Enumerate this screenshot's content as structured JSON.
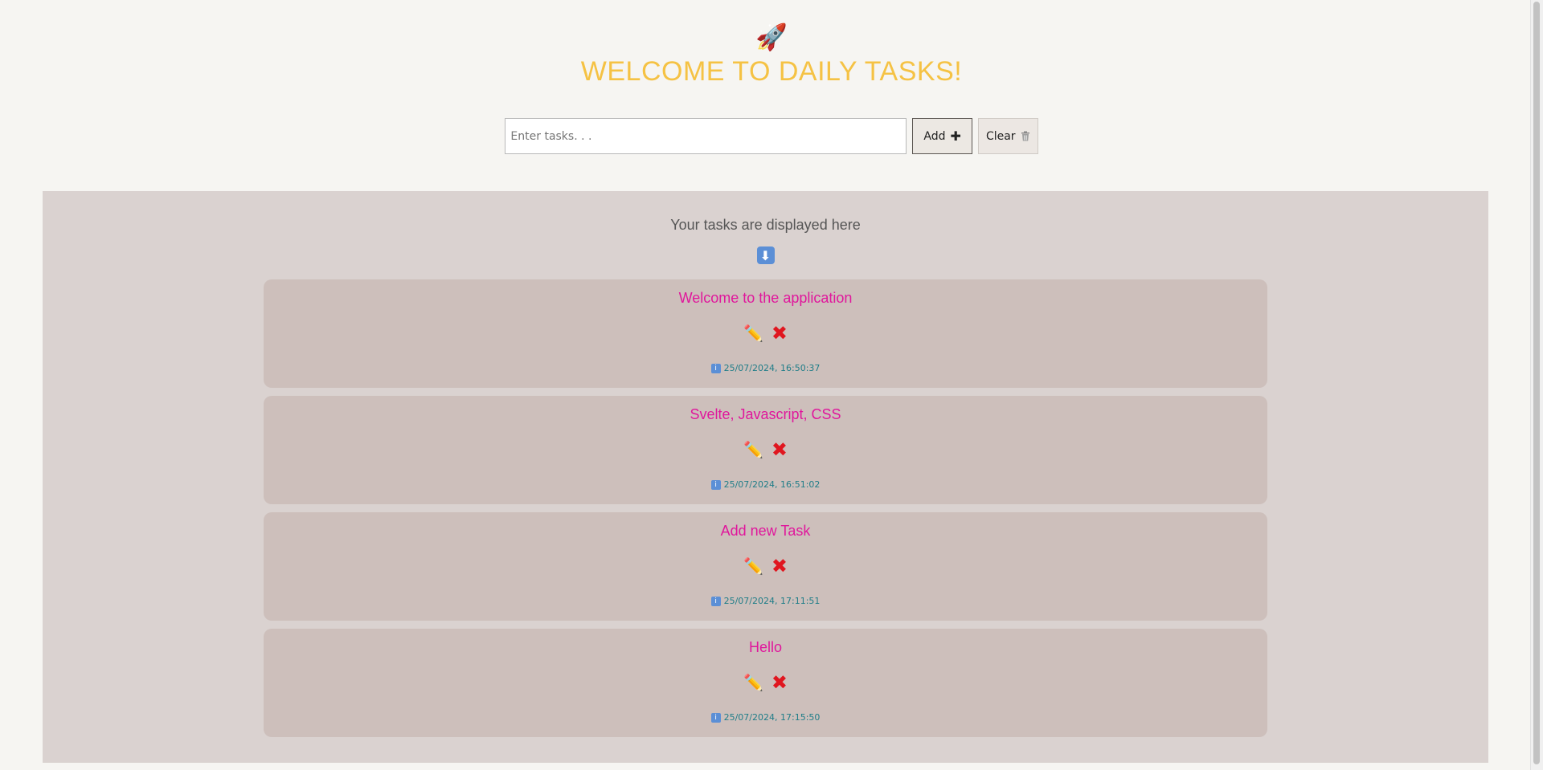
{
  "header": {
    "icon": "rocket-icon",
    "title": "WELCOME TO DAILY TASKS!"
  },
  "task_input": {
    "placeholder": "Enter tasks. . .",
    "value": ""
  },
  "buttons": {
    "add_label": "Add",
    "add_icon": "plus-icon",
    "clear_label": "Clear",
    "clear_icon": "trash-icon"
  },
  "panel": {
    "label": "Your tasks are displayed here",
    "icon": "down-arrow-icon"
  },
  "tasks": [
    {
      "text": "Welcome to the application",
      "timestamp": "25/07/2024, 16:50:37"
    },
    {
      "text": "Svelte, Javascript, CSS",
      "timestamp": "25/07/2024, 16:51:02"
    },
    {
      "text": "Add new Task",
      "timestamp": "25/07/2024, 17:11:51"
    },
    {
      "text": "Hello",
      "timestamp": "25/07/2024, 17:15:50"
    }
  ],
  "colors": {
    "title": "#f5c244",
    "task_text": "#e0179c",
    "timestamp": "#1f7d88",
    "panel_bg": "#dad2d0",
    "card_bg": "#cdbfbb"
  }
}
